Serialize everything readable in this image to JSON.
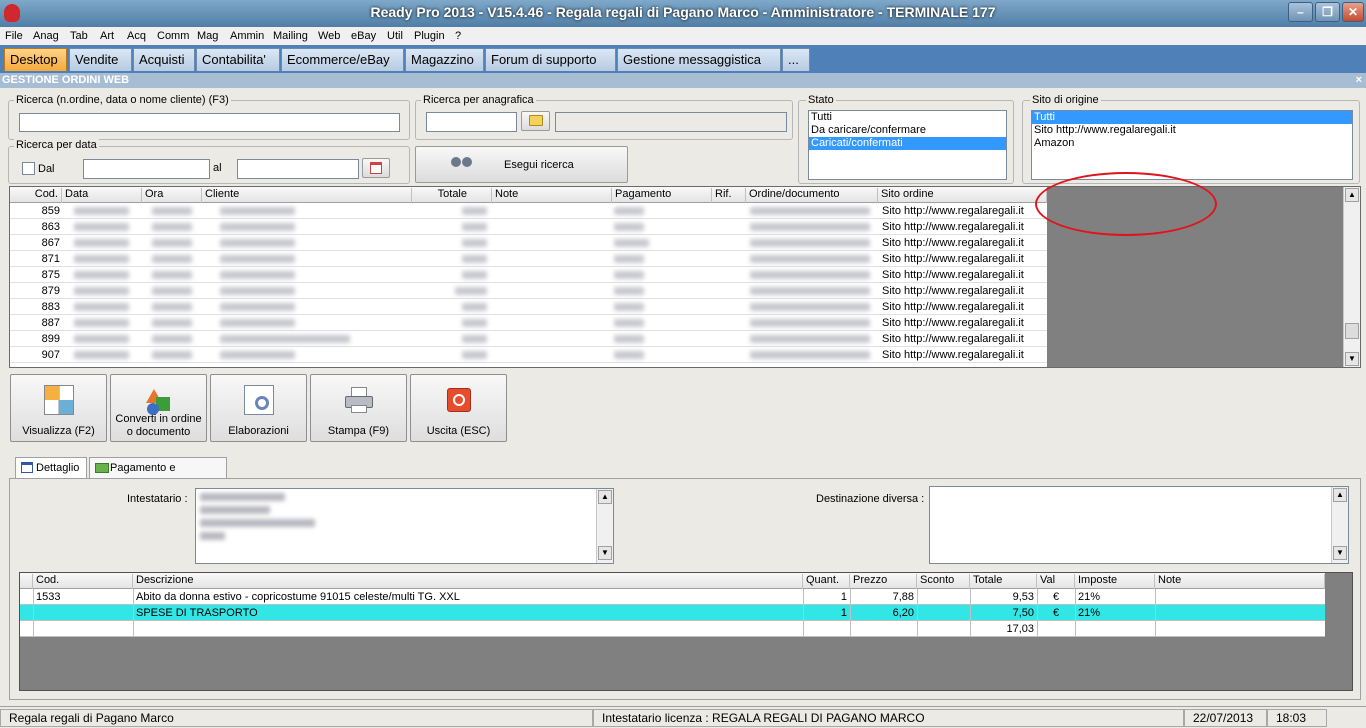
{
  "window": {
    "title": "Ready Pro 2013 - V15.4.46 - Regala regali di Pagano Marco - Amministratore - TERMINALE 177"
  },
  "menu": [
    "File",
    "Anag",
    "Tab",
    "Art",
    "Acq",
    "Comm",
    "Mag",
    "Ammin",
    "Mailing",
    "Web",
    "eBay",
    "Util",
    "Plugin",
    "?"
  ],
  "tabs": [
    "Desktop",
    "Vendite",
    "Acquisti",
    "Contabilita'",
    "Ecommerce/eBay",
    "Magazzino",
    "Forum di supporto",
    "Gestione messaggistica",
    "..."
  ],
  "section": {
    "title": "GESTIONE ORDINI WEB",
    "close": "×"
  },
  "search": {
    "by_text_label": "Ricerca (n.ordine, data o nome cliente) (F3)",
    "by_text_value": "",
    "by_anag_label": "Ricerca per anagrafica",
    "by_date_label": "Ricerca per data",
    "dal_label": "Dal",
    "al_label": "al",
    "execute_label": "Esegui ricerca"
  },
  "stato": {
    "label": "Stato",
    "options": [
      "Tutti",
      "Da caricare/confermare",
      "Caricati/confermati"
    ],
    "selected": 2
  },
  "sito": {
    "label": "Sito di origine",
    "options": [
      "Tutti",
      "Sito http://www.regalaregali.it",
      "Amazon"
    ],
    "selected": 0
  },
  "orders": {
    "columns": [
      "Cod.",
      "Data",
      "Ora",
      "Cliente",
      "Totale",
      "Note",
      "Pagamento",
      "Rif.",
      "Ordine/documento",
      "Sito ordine"
    ],
    "rows": [
      {
        "cod": "859",
        "sito": "Sito http://www.regalaregali.it"
      },
      {
        "cod": "863",
        "sito": "Sito http://www.regalaregali.it"
      },
      {
        "cod": "867",
        "sito": "Sito http://www.regalaregali.it"
      },
      {
        "cod": "871",
        "sito": "Sito http://www.regalaregali.it"
      },
      {
        "cod": "875",
        "sito": "Sito http://www.regalaregali.it"
      },
      {
        "cod": "879",
        "sito": "Sito http://www.regalaregali.it"
      },
      {
        "cod": "883",
        "sito": "Sito http://www.regalaregali.it"
      },
      {
        "cod": "887",
        "sito": "Sito http://www.regalaregali.it"
      },
      {
        "cod": "899",
        "sito": "Sito http://www.regalaregali.it"
      },
      {
        "cod": "907",
        "sito": "Sito http://www.regalaregali.it"
      }
    ]
  },
  "toolbar": {
    "visualizza": "Visualizza (F2)",
    "converti_1": "Converti in ordine",
    "converti_2": "o documento",
    "elaborazioni": "Elaborazioni",
    "stampa": "Stampa (F9)",
    "uscita": "Uscita (ESC)"
  },
  "subtabs": [
    "Dettaglio",
    "Pagamento e trasporto"
  ],
  "detail": {
    "intestatario_label": "Intestatario :",
    "destinazione_label": "Destinazione diversa :",
    "columns": [
      "Cod.",
      "Descrizione",
      "Quant.",
      "Prezzo",
      "Sconto",
      "Totale",
      "Val",
      "Imposte",
      "Note"
    ],
    "rows": [
      {
        "cod": "1533",
        "descrizione": "Abito da donna estivo - copricostume 91015 celeste/multi TG. XXL",
        "quant": "1",
        "prezzo": "7,88",
        "sconto": "",
        "totale": "9,53",
        "val": "€",
        "imposte": "21%",
        "note": ""
      },
      {
        "cod": "",
        "descrizione": "SPESE DI TRASPORTO",
        "quant": "1",
        "prezzo": "6,20",
        "sconto": "",
        "totale": "7,50",
        "val": "€",
        "imposte": "21%",
        "note": ""
      }
    ],
    "grand_total": "17,03"
  },
  "status": {
    "company": "Regala regali di Pagano Marco",
    "license": "Intestatario licenza : REGALA REGALI DI PAGANO MARCO",
    "date": "22/07/2013",
    "time": "18:03"
  }
}
